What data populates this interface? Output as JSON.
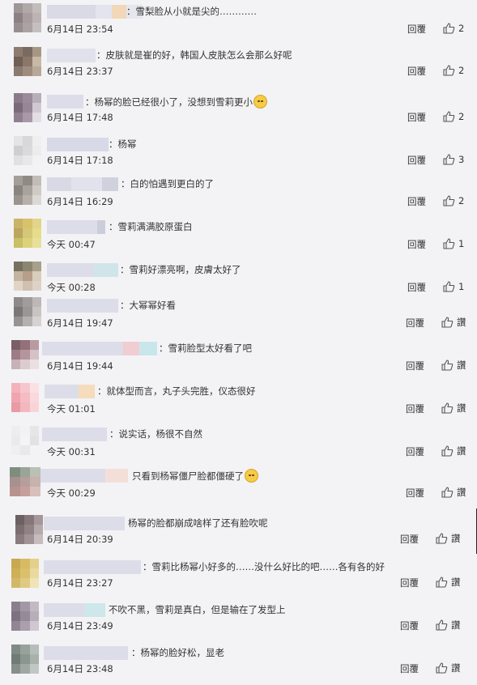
{
  "labels": {
    "reply": "回覆",
    "like_placeholder": "讚"
  },
  "icons": {
    "like": "thumbs-up-icon",
    "emoji_cry": "crying-face-icon",
    "emoji_sweat": "sweat-face-icon"
  },
  "comments": [
    {
      "text": "：雪梨脸从小就是尖的…………",
      "time": "6月14日 23:54",
      "likes": "2"
    },
    {
      "text": "：皮肤就是崔的好，韩国人皮肤怎么会那么好呢",
      "time": "6月14日 23:37",
      "likes": "2"
    },
    {
      "text": "：杨幂的脸已经很小了，没想到雪莉更小",
      "time": "6月14日 17:48",
      "likes": "2"
    },
    {
      "text": "：杨幂",
      "time": "6月14日 17:18",
      "likes": "3"
    },
    {
      "text": "：白的怕遇到更白的了",
      "time": "6月14日 16:29",
      "likes": "2"
    },
    {
      "text": "：雪莉满满胶原蛋白",
      "time": "今天 00:47",
      "likes": "1"
    },
    {
      "text": "：雪莉好漂亮啊，皮膚太好了",
      "time": "今天 00:28",
      "likes": "1"
    },
    {
      "text": "：大幂幂好看",
      "time": "6月14日 19:47",
      "likes": "讚"
    },
    {
      "text": "：雪莉脸型太好看了吧",
      "time": "6月14日 19:44",
      "likes": "讚"
    },
    {
      "text": "：就体型而言，丸子头完胜，仪态很好",
      "time": "今天 01:01",
      "likes": "讚"
    },
    {
      "text": "：说实话，杨很不自然",
      "time": "今天 00:31",
      "likes": "讚"
    },
    {
      "text": "只看到杨幂僵尸脸都僵硬了",
      "time": "今天 00:29",
      "likes": "讚"
    },
    {
      "text": "杨幂的脸都崩成啥样了还有脸吹呢",
      "time": "6月14日 20:39",
      "likes": "讚"
    },
    {
      "text": "：雪莉比杨幂小好多的……没什么好比的吧……各有各的好",
      "time": "6月14日 23:27",
      "likes": "讚"
    },
    {
      "text": "不吹不黑，雪莉是真白，但是输在了发型上",
      "time": "6月14日 23:49",
      "likes": "讚"
    },
    {
      "text": "：杨幂的脸好松，显老",
      "time": "6月14日 23:48",
      "likes": "讚"
    }
  ]
}
